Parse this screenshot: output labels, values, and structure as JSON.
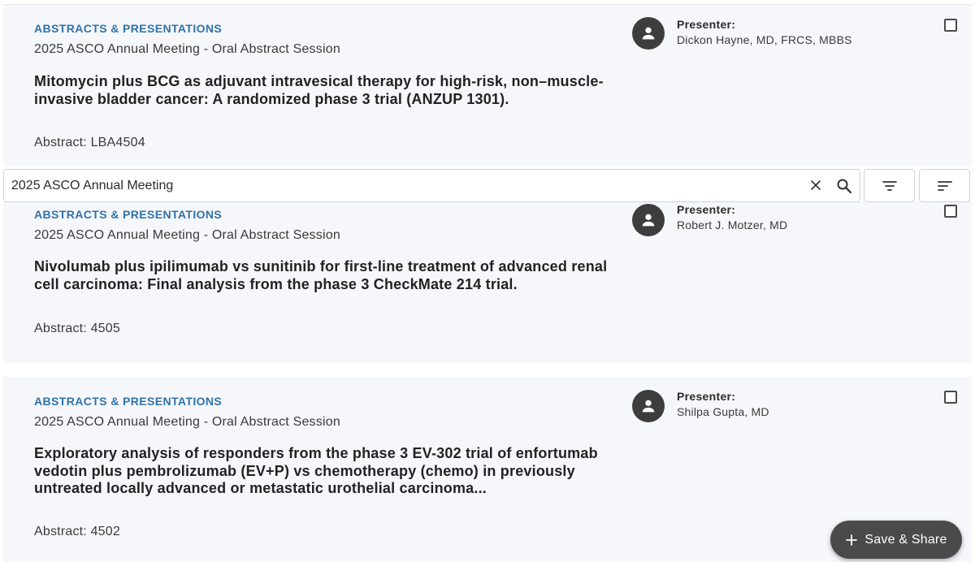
{
  "search": {
    "value": "2025 ASCO Annual Meeting"
  },
  "results": [
    {
      "category": "ABSTRACTS & PRESENTATIONS",
      "session": "2025 ASCO Annual Meeting - Oral Abstract Session",
      "title": "Mitomycin plus BCG as adjuvant intravesical therapy for high-risk, non–muscle-invasive bladder cancer: A randomized phase 3 trial (ANZUP 1301).",
      "abstract": "Abstract: LBA4504",
      "presenter_label": "Presenter:",
      "presenter_name": "Dickon Hayne, MD, FRCS, MBBS"
    },
    {
      "category": "ABSTRACTS & PRESENTATIONS",
      "session": "2025 ASCO Annual Meeting - Oral Abstract Session",
      "title": "Nivolumab plus ipilimumab vs sunitinib for first-line treatment of advanced renal cell carcinoma: Final analysis from the phase 3 CheckMate 214 trial.",
      "abstract": "Abstract: 4505",
      "presenter_label": "Presenter:",
      "presenter_name": "Robert J. Motzer, MD"
    },
    {
      "category": "ABSTRACTS & PRESENTATIONS",
      "session": "2025 ASCO Annual Meeting - Oral Abstract Session",
      "title": "Exploratory analysis of responders from the phase 3 EV-302 trial of enfortumab vedotin plus pembrolizumab (EV+P) vs chemotherapy (chemo) in previously untreated locally advanced or metastatic urothelial carcinoma...",
      "abstract": "Abstract: 4502",
      "presenter_label": "Presenter:",
      "presenter_name": "Shilpa Gupta, MD"
    }
  ],
  "fab": {
    "label": "Save & Share",
    "icon": "plus-icon"
  },
  "icons": {
    "avatar": "person-icon",
    "clear": "close-icon",
    "search": "search-icon",
    "filter": "filter-icon",
    "sort": "sort-icon"
  },
  "colors": {
    "category": "#2f72a8",
    "card_bg": "#f6f7fb",
    "fab_bg": "#4a4a4a",
    "avatar_bg": "#3d3d3d"
  }
}
